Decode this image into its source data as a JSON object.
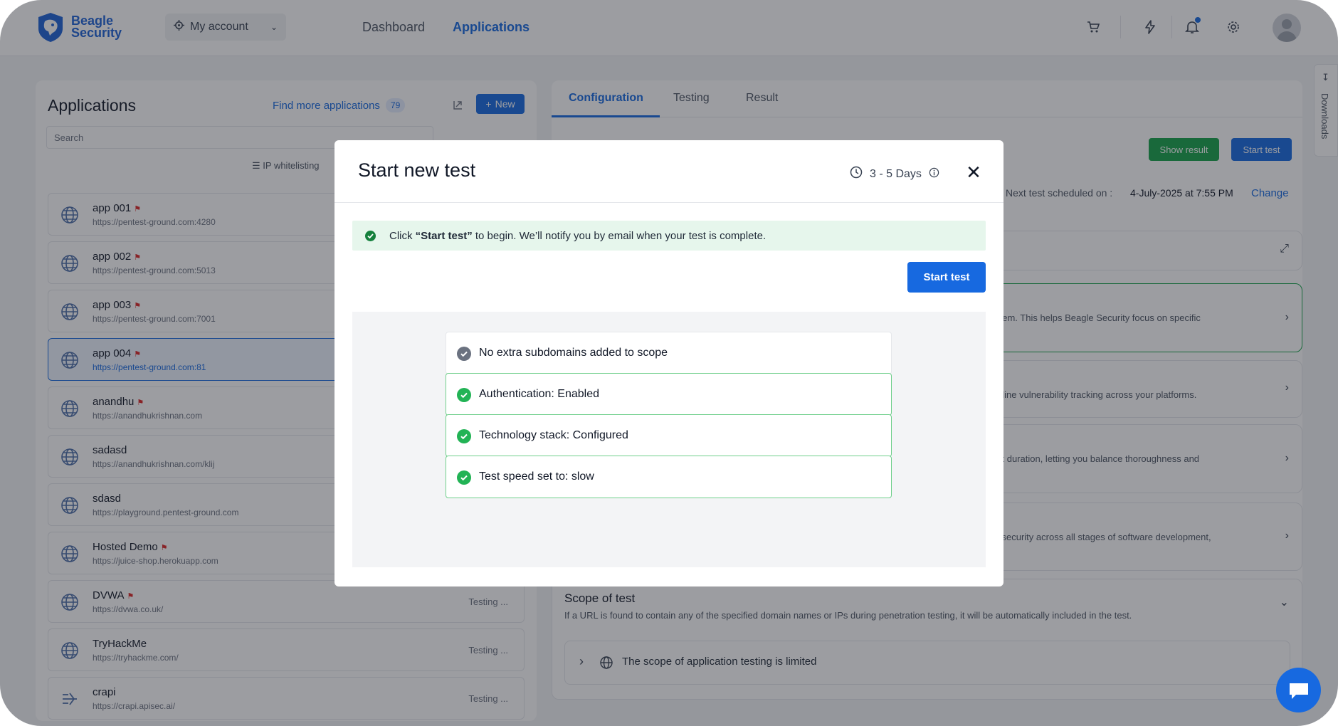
{
  "header": {
    "logo_line1": "Beagle",
    "logo_line2": "Security",
    "account_label": "My account",
    "nav": [
      {
        "label": "Dashboard",
        "active": false
      },
      {
        "label": "Applications",
        "active": true
      }
    ],
    "icons": [
      "cart-icon",
      "bolt-icon",
      "bell-icon",
      "gear-icon",
      "avatar"
    ]
  },
  "left_panel": {
    "title": "Applications",
    "find_more_label": "Find more applications",
    "find_more_count": "79",
    "new_button": "New",
    "search_placeholder": "Search",
    "ip_whitelisting": "IP whitelisting",
    "apps": [
      {
        "name": "app 001",
        "url": "https://pentest-ground.com:4280",
        "flag": true,
        "status": ""
      },
      {
        "name": "app 002",
        "url": "https://pentest-ground.com:5013",
        "flag": true,
        "status": ""
      },
      {
        "name": "app 003",
        "url": "https://pentest-ground.com:7001",
        "flag": true,
        "status": ""
      },
      {
        "name": "app 004",
        "url": "https://pentest-ground.com:81",
        "flag": true,
        "status": "",
        "selected": true
      },
      {
        "name": "anandhu",
        "url": "https://anandhukrishnan.com",
        "flag": true,
        "status": ""
      },
      {
        "name": "sadasd",
        "url": "https://anandhukrishnan.com/klij",
        "flag": false,
        "status": ""
      },
      {
        "name": "sdasd",
        "url": "https://playground.pentest-ground.com",
        "flag": false,
        "status": ""
      },
      {
        "name": "Hosted Demo",
        "url": "https://juice-shop.herokuapp.com",
        "flag": true,
        "status": ""
      },
      {
        "name": "DVWA",
        "url": "https://dvwa.co.uk/",
        "flag": true,
        "status": "Testing ..."
      },
      {
        "name": "TryHackMe",
        "url": "https://tryhackme.com/",
        "flag": false,
        "status": "Testing ..."
      },
      {
        "name": "crapi",
        "url": "https://crapi.apisec.ai/",
        "flag": false,
        "status": "Testing ..."
      }
    ]
  },
  "right_panel": {
    "tabs": [
      "Configuration",
      "Testing",
      "Result"
    ],
    "show_result": "Show result",
    "start_test": "Start test",
    "next_test_label": "Next test scheduled on :",
    "next_test_date": "4-July-2025 at 7:55 PM",
    "change_link": "Change",
    "cards": [
      "hem. This helps Beagle Security focus on specific",
      "nline vulnerability tracking across your platforms.",
      "st duration, letting you balance thoroughness and",
      "l security across all stages of software development,"
    ],
    "scope": {
      "title": "Scope of test",
      "description": "If a URL is found to contain any of the specified domain names or IPs during penetration testing, it will be automatically included in the test.",
      "row_text": "The scope of application testing is limited"
    },
    "downloads": "Downloads"
  },
  "modal": {
    "title": "Start new test",
    "duration": "3 - 5 Days",
    "alert_prefix": "Click ",
    "alert_strong": "“Start test”",
    "alert_suffix": " to begin. We’ll notify you by email when your test is complete.",
    "start_button": "Start test",
    "checks": [
      {
        "label": "No extra subdomains added to scope",
        "status": "neutral"
      },
      {
        "label": "Authentication: Enabled",
        "status": "ok"
      },
      {
        "label": "Technology stack: Configured",
        "status": "ok"
      },
      {
        "label": "Test speed set to: slow",
        "status": "ok"
      }
    ]
  },
  "colors": {
    "accent": "#1769e0",
    "success": "#22b355",
    "flag": "#dc2626"
  }
}
